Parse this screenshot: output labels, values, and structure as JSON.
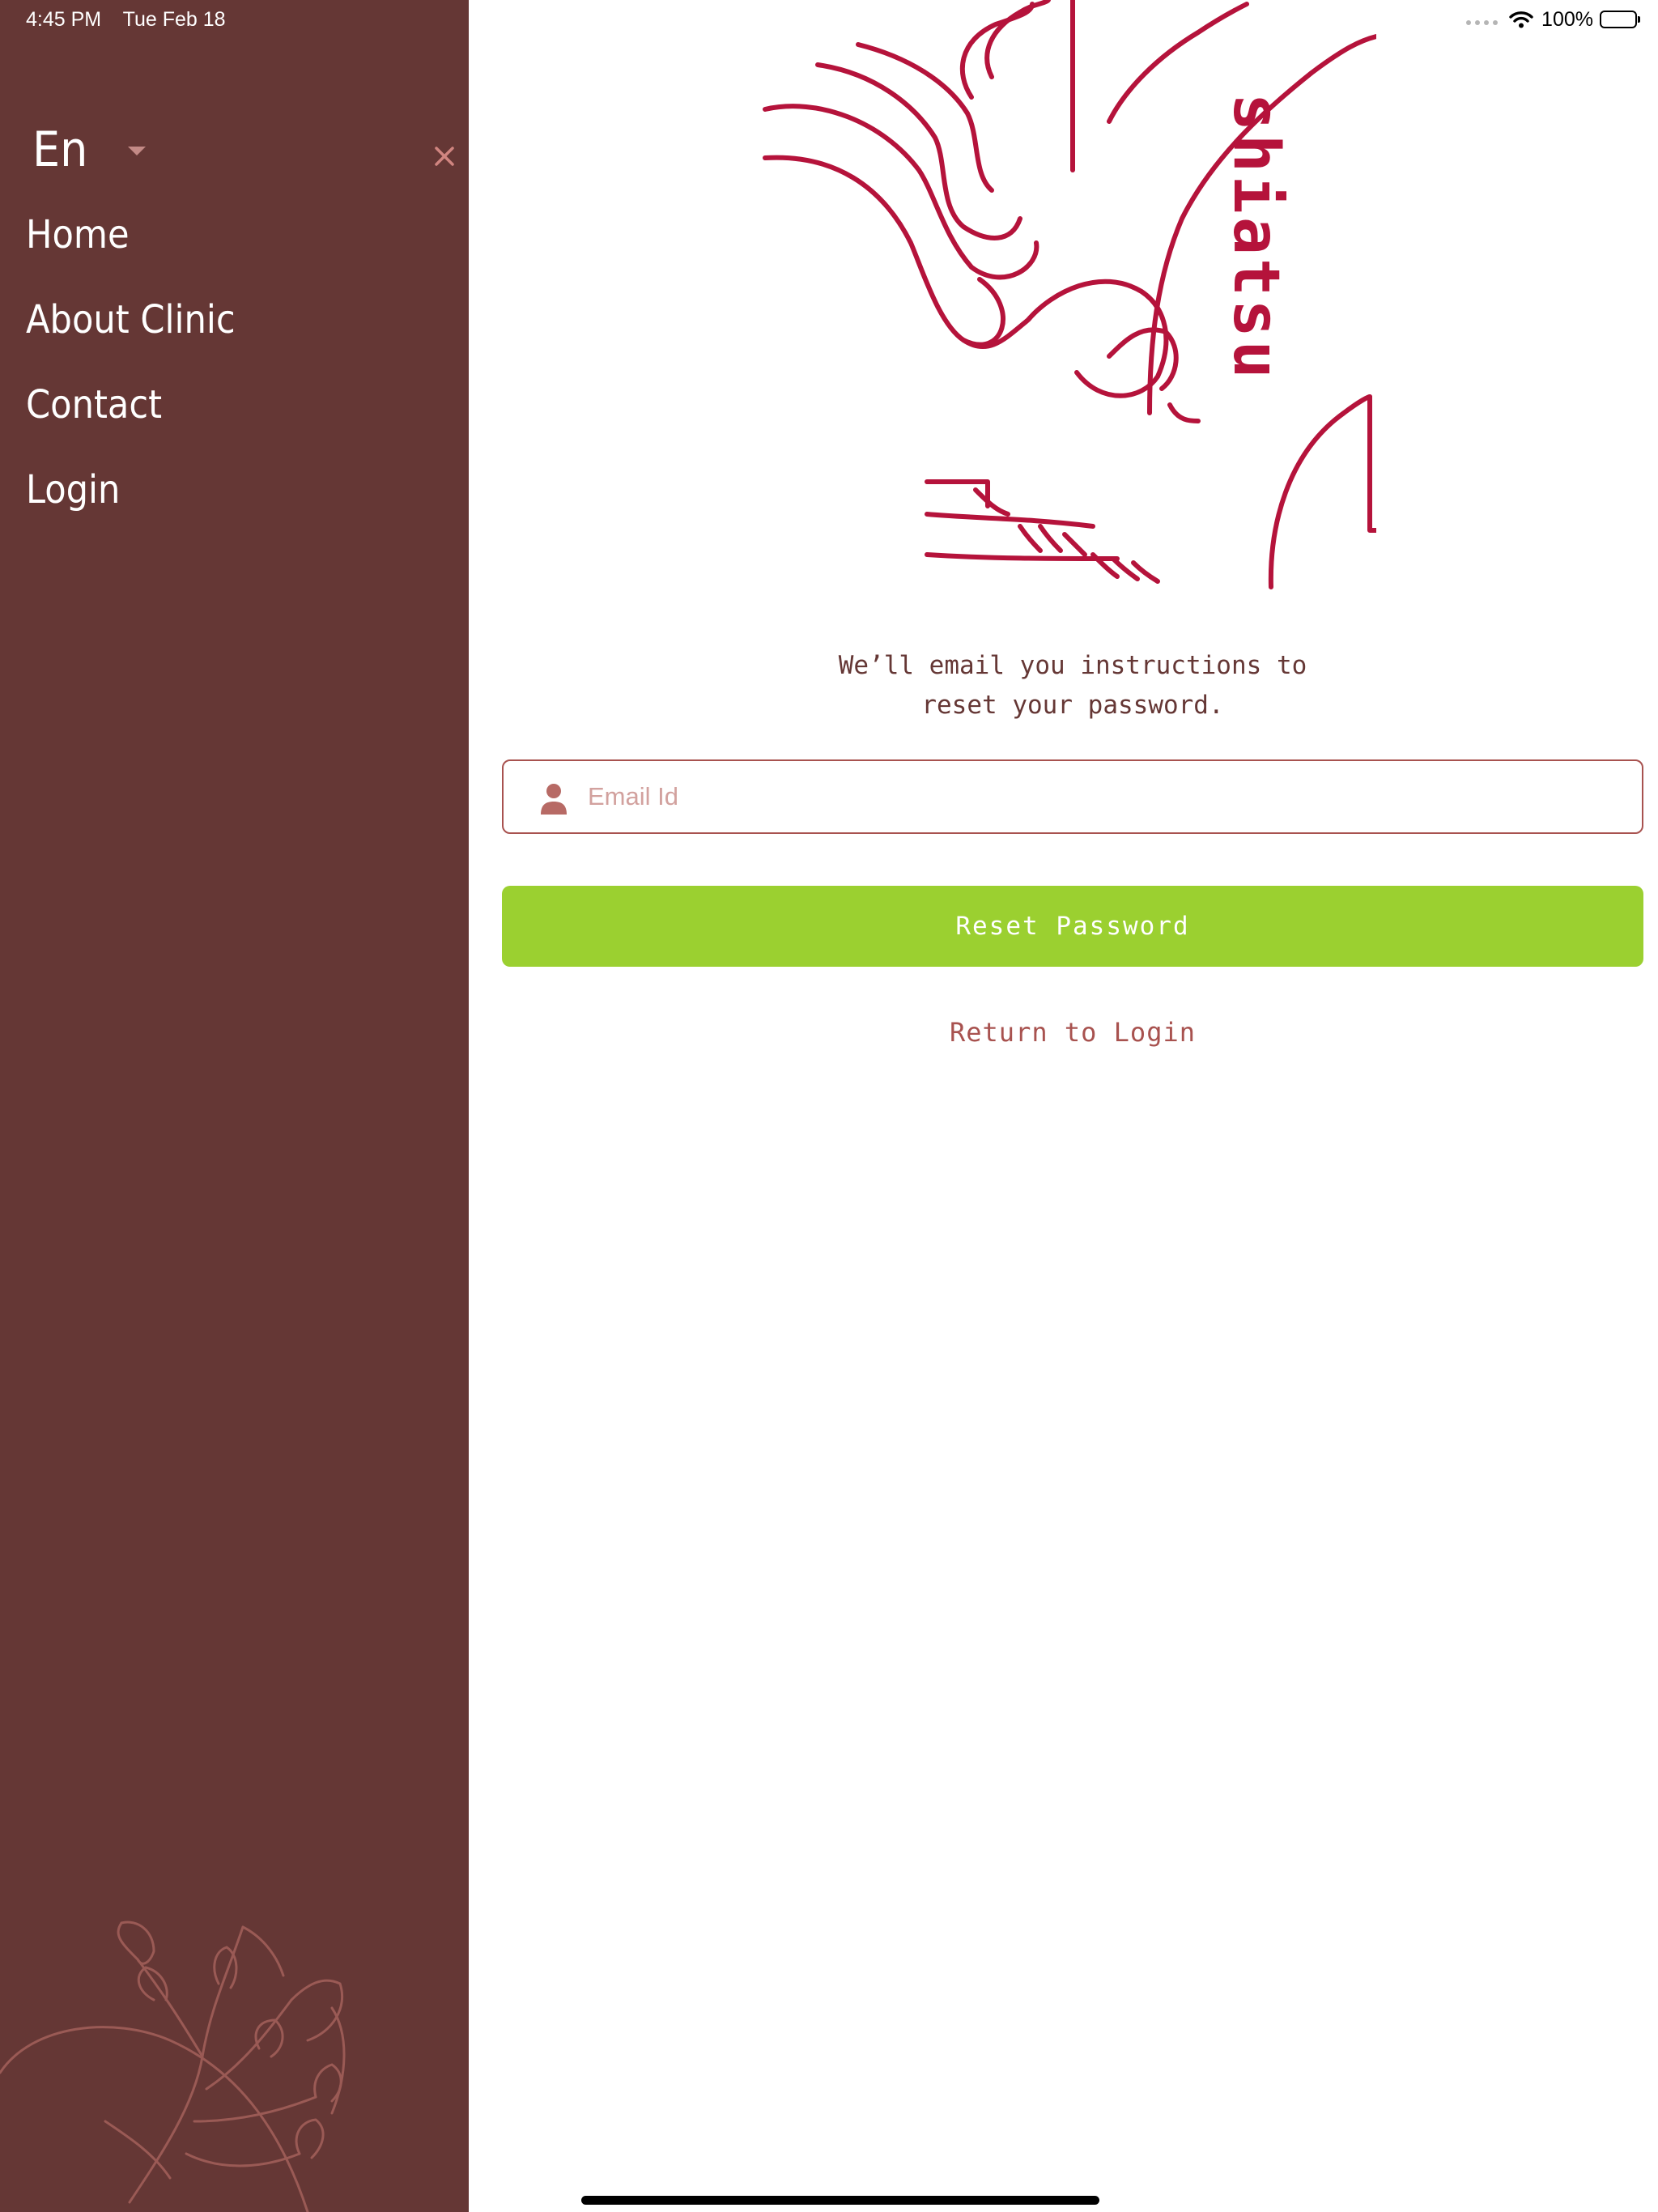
{
  "status_bar": {
    "time": "4:45 PM",
    "date": "Tue Feb 18",
    "battery": "100%",
    "battery_level": 1.0
  },
  "sidebar": {
    "language": "En",
    "items": [
      {
        "label": "Home"
      },
      {
        "label": "About Clinic"
      },
      {
        "label": "Contact"
      },
      {
        "label": "Login"
      }
    ]
  },
  "logo": {
    "wordmark": "shiatsu"
  },
  "reset": {
    "instructions": "We’ll email you instructions to\nreset your password.",
    "email_placeholder": "Email Id",
    "email_value": "",
    "button_label": "Reset Password",
    "return_label": "Return to Login"
  },
  "colors": {
    "sidebar_bg": "#653735",
    "logo_red": "#b5133b",
    "button_green": "#9bd030",
    "field_border": "#a8524f",
    "text_brown": "#653735"
  }
}
